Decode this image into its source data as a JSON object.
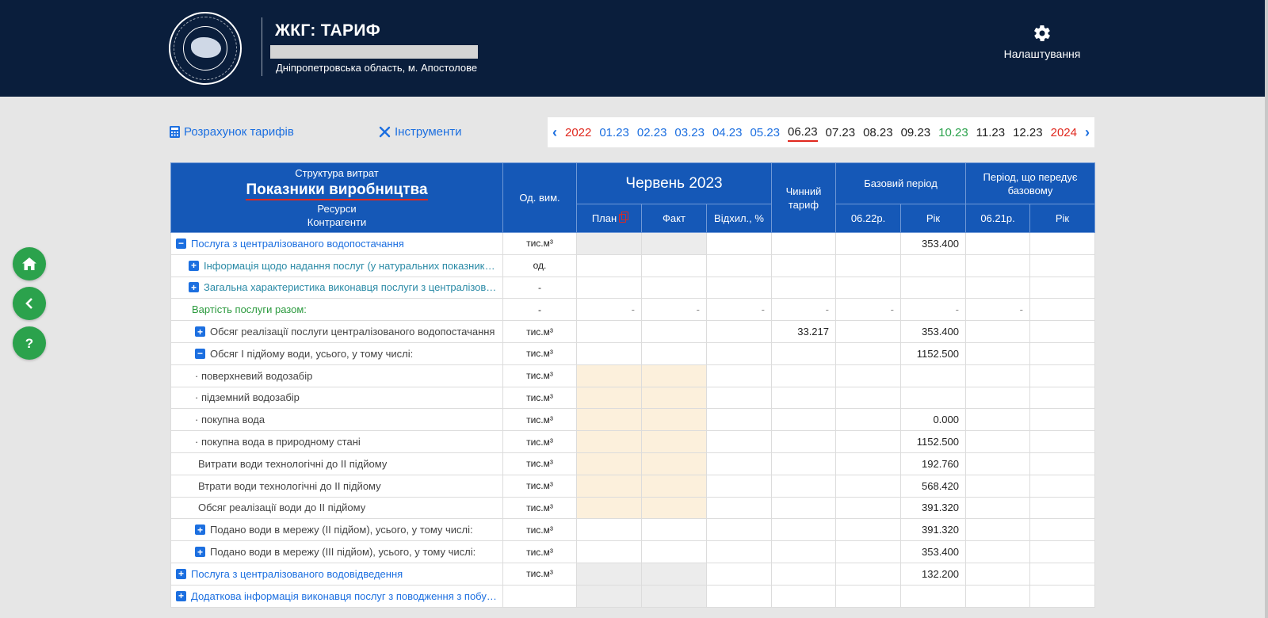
{
  "header": {
    "app_title": "ЖКГ: ТАРИФ",
    "region": "Дніпропетровська область, м. Апостолове",
    "settings_label": "Налаштування"
  },
  "toolbar": {
    "calc_label": "Розрахунок тарифів",
    "tools_label": "Інструменти"
  },
  "periods": [
    {
      "label": "2022",
      "color": "#e0281e"
    },
    {
      "label": "01.23",
      "color": "#1c6fe0"
    },
    {
      "label": "02.23",
      "color": "#1c6fe0"
    },
    {
      "label": "03.23",
      "color": "#1c6fe0"
    },
    {
      "label": "04.23",
      "color": "#1c6fe0"
    },
    {
      "label": "05.23",
      "color": "#1c6fe0"
    },
    {
      "label": "06.23",
      "color": "#222222",
      "active": true
    },
    {
      "label": "07.23",
      "color": "#222222"
    },
    {
      "label": "08.23",
      "color": "#222222"
    },
    {
      "label": "09.23",
      "color": "#222222"
    },
    {
      "label": "10.23",
      "color": "#2ba24c"
    },
    {
      "label": "11.23",
      "color": "#222222"
    },
    {
      "label": "12.23",
      "color": "#222222"
    },
    {
      "label": "2024",
      "color": "#e0281e"
    }
  ],
  "table": {
    "header": {
      "struct_label": "Структура витрат",
      "title": "Показники виробництва",
      "resources": "Ресурси",
      "contractors": "Контрагенти",
      "unit": "Од. вим.",
      "month": "Червень 2023",
      "current_tariff": "Чинний тариф",
      "base_period": "Базовий період",
      "prev_period": "Період, що передує базовому",
      "plan": "План",
      "fact": "Факт",
      "deviation": "Відхил., %",
      "base_col1": "06.22р.",
      "base_col2": "Рік",
      "prev_col1": "06.21р.",
      "prev_col2": "Рік"
    },
    "rows": [
      {
        "name": "Послуга з централізованого водопостачання",
        "unit": "тис.м³",
        "vals": [
          "",
          "",
          "",
          "",
          "",
          "353.400",
          "",
          ""
        ]
      },
      {
        "name": "Інформація щодо надання послуг (у натуральних показниках)",
        "unit": "од.",
        "vals": [
          "",
          "",
          "",
          "",
          "",
          "",
          "",
          ""
        ]
      },
      {
        "name": "Загальна характеристика виконавця послуги з централізованого водопостачання",
        "unit": "-",
        "vals": [
          "",
          "",
          "",
          "",
          "",
          "",
          "",
          ""
        ]
      },
      {
        "name": "Вартість послуги разом:",
        "unit": "-",
        "vals": [
          "-",
          "-",
          "-",
          "-",
          "-",
          "-",
          "-",
          ""
        ]
      },
      {
        "name": "Обсяг реалізації послуги централізованого водопостачання",
        "unit": "тис.м³",
        "vals": [
          "",
          "",
          "",
          "33.217",
          "",
          "353.400",
          "",
          ""
        ]
      },
      {
        "name": "Обсяг I підйому води, усього, у тому числі:",
        "unit": "тис.м³",
        "vals": [
          "",
          "",
          "",
          "",
          "",
          "1152.500",
          "",
          ""
        ]
      },
      {
        "name": "· поверхневий водозабір",
        "unit": "тис.м³",
        "vals": [
          "",
          "",
          "",
          "",
          "",
          "",
          "",
          ""
        ]
      },
      {
        "name": "· підземний водозабір",
        "unit": "тис.м³",
        "vals": [
          "",
          "",
          "",
          "",
          "",
          "",
          "",
          ""
        ]
      },
      {
        "name": "· покупна вода",
        "unit": "тис.м³",
        "vals": [
          "",
          "",
          "",
          "",
          "",
          "0.000",
          "",
          ""
        ]
      },
      {
        "name": "· покупна вода в природному стані",
        "unit": "тис.м³",
        "vals": [
          "",
          "",
          "",
          "",
          "",
          "1152.500",
          "",
          ""
        ]
      },
      {
        "name": "Витрати води технологічні до II підйому",
        "unit": "тис.м³",
        "vals": [
          "",
          "",
          "",
          "",
          "",
          "192.760",
          "",
          ""
        ]
      },
      {
        "name": "Втрати води технологічні до II підйому",
        "unit": "тис.м³",
        "vals": [
          "",
          "",
          "",
          "",
          "",
          "568.420",
          "",
          ""
        ]
      },
      {
        "name": "Обсяг реалізації води до II підйому",
        "unit": "тис.м³",
        "vals": [
          "",
          "",
          "",
          "",
          "",
          "391.320",
          "",
          ""
        ]
      },
      {
        "name": "Подано води в мережу (II підйом), усього, у тому числі:",
        "unit": "тис.м³",
        "vals": [
          "",
          "",
          "",
          "",
          "",
          "391.320",
          "",
          ""
        ]
      },
      {
        "name": "Подано води в мережу (III підйом), усього, у тому числі:",
        "unit": "тис.м³",
        "vals": [
          "",
          "",
          "",
          "",
          "",
          "353.400",
          "",
          ""
        ]
      },
      {
        "name": "Послуга з централізованого водовідведення",
        "unit": "тис.м³",
        "vals": [
          "",
          "",
          "",
          "",
          "",
          "132.200",
          "",
          ""
        ]
      },
      {
        "name": "Додаткова інформація виконавця послуг з поводження з побутовими відходами",
        "unit": "",
        "vals": [
          "",
          "",
          "",
          "",
          "",
          "",
          "",
          ""
        ]
      }
    ]
  },
  "side_buttons": [
    "home-icon",
    "back-icon",
    "help-icon"
  ]
}
